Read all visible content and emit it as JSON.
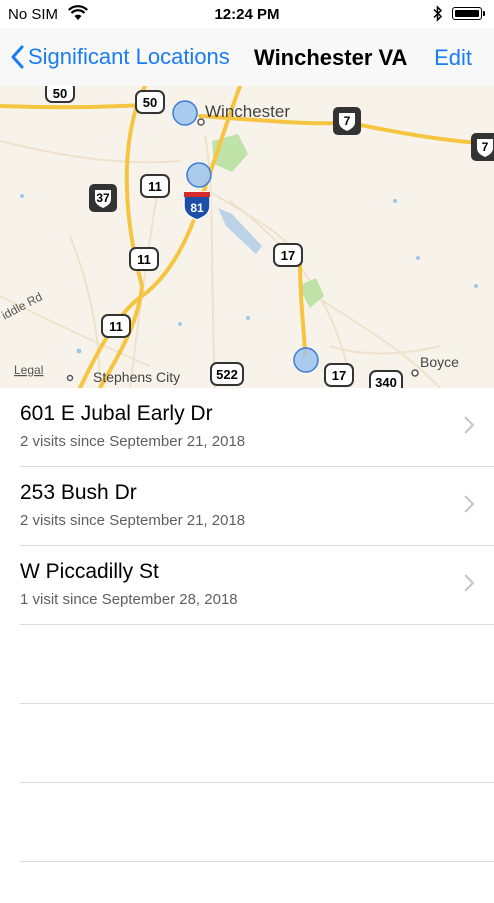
{
  "status": {
    "carrier": "No SIM",
    "time": "12:24 PM"
  },
  "nav": {
    "back_label": "Significant Locations",
    "title": "Winchester VA",
    "edit_label": "Edit"
  },
  "map": {
    "labels": {
      "winchester": "Winchester",
      "stephens_city": "Stephens City",
      "boyce": "Boyce",
      "legal": "Legal",
      "road": "iddle Rd"
    },
    "shields": {
      "us50a": "50",
      "us50b": "50",
      "va7a": "7",
      "va7b": "7",
      "va37": "37",
      "us11a": "11",
      "us11b": "11",
      "us11c": "11",
      "i81": "81",
      "us17a": "17",
      "us17b": "17",
      "us522": "522",
      "us340": "340"
    }
  },
  "locations": [
    {
      "name": "601 E Jubal Early Dr",
      "visits": "2 visits since September 21, 2018"
    },
    {
      "name": "253 Bush Dr",
      "visits": "2 visits since September 21, 2018"
    },
    {
      "name": "W Piccadilly St",
      "visits": "1 visit since September 28, 2018"
    }
  ],
  "colors": {
    "accent": "#1a7cf2",
    "map_bg": "#f8f3ea",
    "highway": "#f5c542"
  }
}
